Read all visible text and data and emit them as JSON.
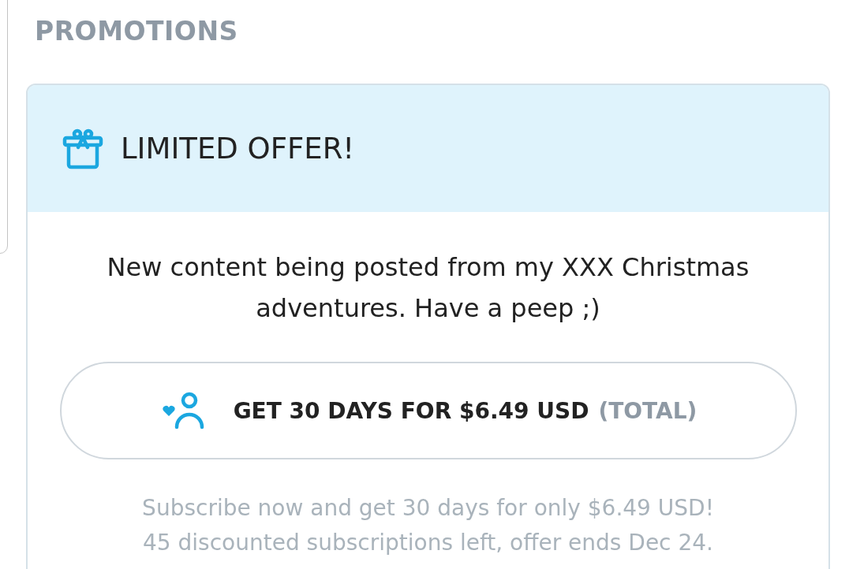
{
  "section_title": "PROMOTIONS",
  "offer": {
    "title": "LIMITED OFFER!",
    "message": "New content being posted from my XXX Christmas adventures. Have a peep ;)",
    "button": {
      "label": "GET 30 DAYS FOR $6.49 USD",
      "note": "(TOTAL)"
    },
    "footnote": [
      "Subscribe now and get 30 days for only $6.49 USD!",
      "45 discounted subscriptions left, offer ends Dec 24."
    ]
  }
}
